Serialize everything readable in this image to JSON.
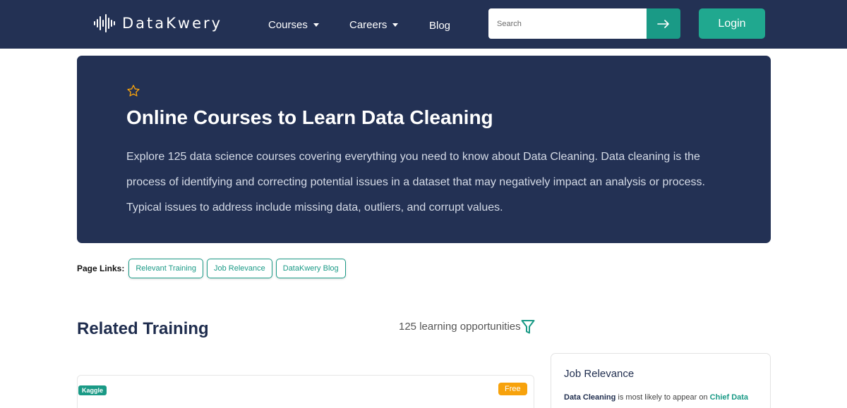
{
  "colors": {
    "navy": "#233154",
    "teal": "#1a9a86",
    "login_teal": "#20a88f",
    "orange": "#f7a20c",
    "star": "#f7a20c"
  },
  "navbar": {
    "logo_text": "DataKwery",
    "logo_icon": "sound-wave-icon",
    "items": [
      {
        "label": "Courses",
        "has_dropdown": true
      },
      {
        "label": "Careers",
        "has_dropdown": true
      },
      {
        "label": "Blog",
        "has_dropdown": false
      }
    ],
    "search": {
      "placeholder": "Search",
      "value": "",
      "button_icon": "arrow-right-icon"
    },
    "login_label": "Login"
  },
  "hero": {
    "icon": "star-outline-icon",
    "title": "Online Courses to Learn Data Cleaning",
    "description": "Explore 125 data science courses covering everything you need to know about Data Cleaning. Data cleaning is the process of identifying and correcting potential issues in a dataset that may negatively impact an analysis or process. Typical issues to address include missing data, outliers, and corrupt values."
  },
  "page_links": {
    "label": "Page Links:",
    "links": [
      "Relevant Training",
      "Job Relevance",
      "DataKwery Blog"
    ]
  },
  "related_training": {
    "title": "Related Training",
    "count_text": "125 learning opportunities",
    "filter_icon": "filter-icon"
  },
  "course_card": {
    "provider": "Kaggle",
    "price_badge": "Free"
  },
  "job_relevance": {
    "title": "Job Relevance",
    "skill": "Data Cleaning",
    "middle_text": " is most likely to appear on ",
    "role": "Chief Data"
  }
}
